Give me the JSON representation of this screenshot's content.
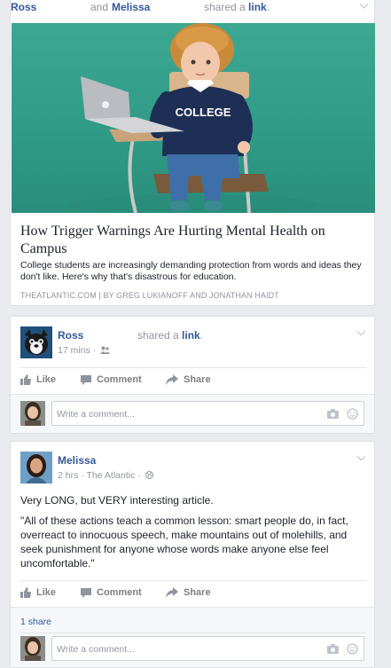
{
  "story1": {
    "actor1": "Ross",
    "conj": "and",
    "actor2": "Melissa",
    "shared_prefix": "shared a",
    "shared_link": "link",
    "shared_suffix": ".",
    "image_shirt_text": "COLLEGE",
    "title": "How Trigger Warnings Are Hurting Mental Health on Campus",
    "description": "College students are increasingly demanding protection from words and ideas they don't like. Here's why that's disastrous for education.",
    "source": "THEATLANTIC.COM | BY GREG LUKIANOFF AND JONATHAN HAIDT"
  },
  "story2": {
    "name": "Ross",
    "shared_prefix": "shared a",
    "shared_link": "link",
    "shared_suffix": ".",
    "time": "17 mins ·",
    "actions": {
      "like": "Like",
      "comment": "Comment",
      "share": "Share"
    },
    "comment_placeholder": "Write a comment..."
  },
  "story3": {
    "name": "Melissa",
    "meta": "2 hrs · The Atlantic ·",
    "text1": "Very LONG, but VERY interesting article.",
    "text2": "\"All of these actions teach a common lesson: smart people do, in fact, overreact to innocuous speech, make mountains out of molehills, and seek punishment for anyone whose words make anyone else feel uncomfortable.\"",
    "actions": {
      "like": "Like",
      "comment": "Comment",
      "share": "Share"
    },
    "shares": "1 share",
    "comment_placeholder": "Write a comment..."
  },
  "colors": {
    "link": "#365899",
    "meta": "#90949c",
    "image_bg": "#3da892"
  },
  "icons": [
    "chevron-down-icon",
    "friends-icon",
    "globe-icon",
    "like-icon",
    "comment-icon",
    "share-icon",
    "camera-icon",
    "emoji-icon"
  ]
}
